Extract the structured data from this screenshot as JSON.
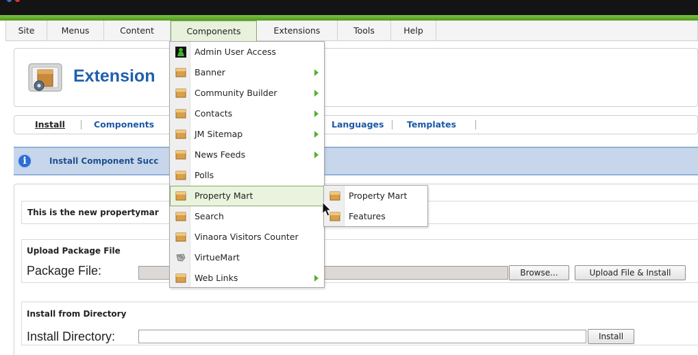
{
  "menubar": {
    "items": [
      "Site",
      "Menus",
      "Content",
      "Components",
      "Extensions",
      "Tools",
      "Help"
    ],
    "active": "Components"
  },
  "header": {
    "title": "Extension"
  },
  "subtabs": [
    "Install",
    "Components",
    "Languages",
    "Templates"
  ],
  "message": {
    "text": "Install Component Succ"
  },
  "install_text": "This is the new propertymar",
  "upload": {
    "title": "Upload Package File",
    "field_label": "Package File:",
    "browse_label": "Browse...",
    "submit_label": "Upload File & Install"
  },
  "directory": {
    "title": "Install from Directory",
    "field_label": "Install Directory:",
    "submit_label": "Install"
  },
  "dropdown": {
    "items": [
      {
        "label": "Admin User Access",
        "icon": "admin-user-access-icon",
        "arrow": false
      },
      {
        "label": "Banner",
        "icon": "component-icon",
        "arrow": true
      },
      {
        "label": "Community Builder",
        "icon": "component-icon",
        "arrow": true
      },
      {
        "label": "Contacts",
        "icon": "component-icon",
        "arrow": true
      },
      {
        "label": "JM Sitemap",
        "icon": "component-icon",
        "arrow": true
      },
      {
        "label": "News Feeds",
        "icon": "component-icon",
        "arrow": true
      },
      {
        "label": "Polls",
        "icon": "component-icon",
        "arrow": false
      },
      {
        "label": "Property Mart",
        "icon": "component-icon",
        "arrow": false
      },
      {
        "label": "Search",
        "icon": "component-icon",
        "arrow": false
      },
      {
        "label": "Vinaora Visitors Counter",
        "icon": "component-icon",
        "arrow": false
      },
      {
        "label": "VirtueMart",
        "icon": "virtuemart-icon",
        "arrow": false
      },
      {
        "label": "Web Links",
        "icon": "component-icon",
        "arrow": true
      }
    ],
    "highlighted": "Property Mart"
  },
  "submenu": {
    "items": [
      "Property Mart",
      "Features"
    ]
  },
  "colors": {
    "accent_green": "#5aa62a",
    "link_blue": "#1a58a6",
    "message_bg": "#c7d6ea"
  }
}
